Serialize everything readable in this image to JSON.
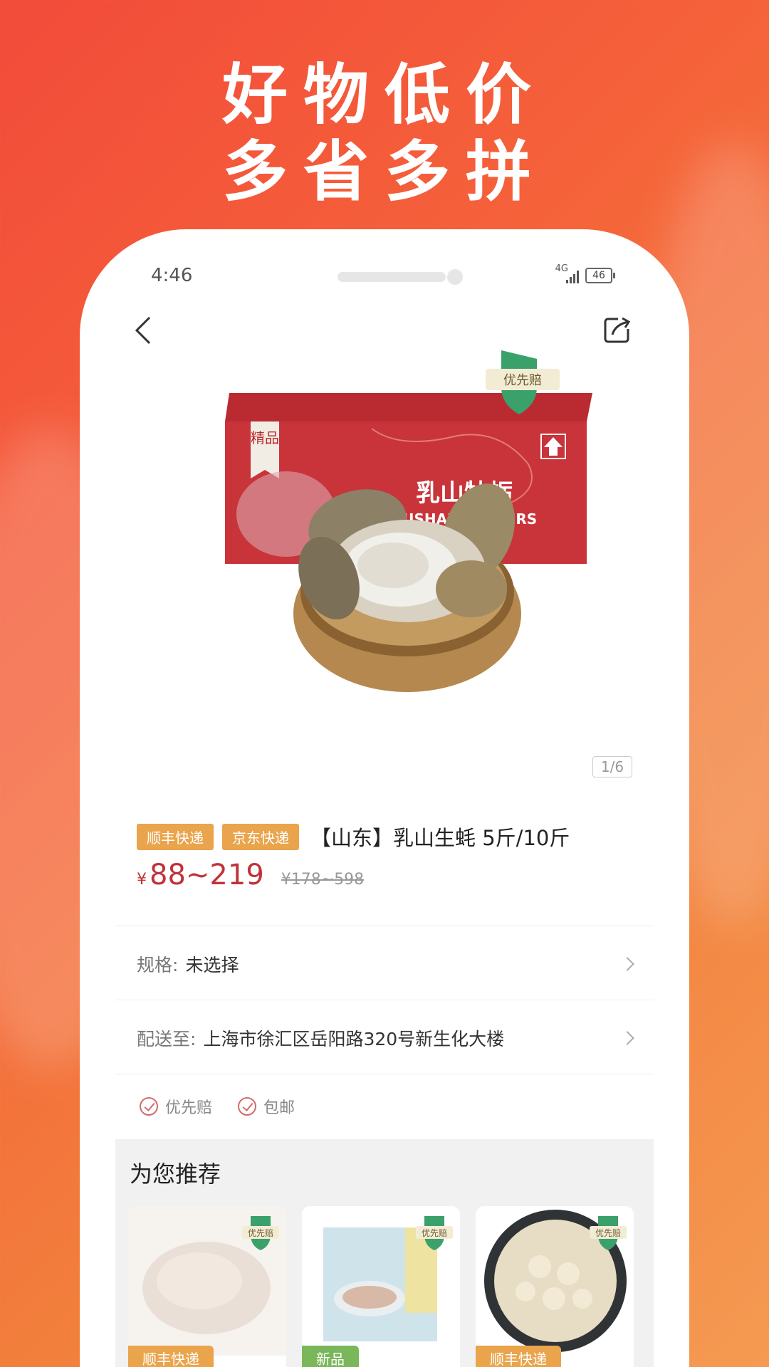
{
  "promo": {
    "headline_line1": "好物低价",
    "headline_line2": "多省多拼"
  },
  "status_bar": {
    "time": "4:46",
    "network": "4G",
    "battery": "46"
  },
  "product": {
    "guarantee_badge": "优先赔",
    "image_page": "1/6",
    "tags": [
      "顺丰快递",
      "京东快递"
    ],
    "title": "【山东】乳山生蚝 5斤/10斤",
    "price_symbol": "¥",
    "price": "88~219",
    "original_price": "¥178~598",
    "box_print": {
      "label": "精品",
      "brand_cn": "乳山牡蛎",
      "brand_en": "RUSHAN OYSTERS"
    }
  },
  "options": {
    "spec_label": "规格:",
    "spec_value": "未选择",
    "delivery_label": "配送至:",
    "delivery_value": "上海市徐汇区岳阳路320号新生化大楼"
  },
  "guarantees": [
    "优先赔",
    "包邮"
  ],
  "recommend": {
    "title": "为您推荐",
    "cards": [
      {
        "tag": "顺丰快递",
        "badge": "优先赔"
      },
      {
        "tag": "新品",
        "badge": "优先赔"
      },
      {
        "tag": "顺丰快递",
        "badge": "优先赔"
      }
    ]
  },
  "colors": {
    "price": "#c0323a",
    "tag_orange": "#e9a44c",
    "tag_green": "#7ab65a",
    "box_red": "#c8343a"
  }
}
